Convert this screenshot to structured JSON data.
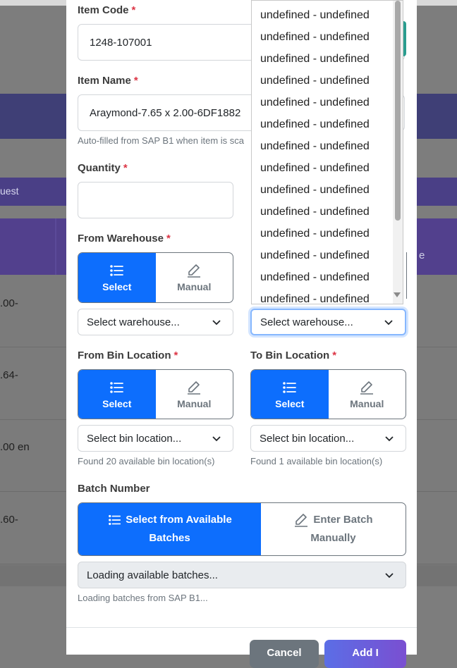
{
  "background": {
    "left_fragments": [
      "uest",
      ".00-",
      ".64-",
      ".00 en",
      ".60-"
    ],
    "right_fragment": "e"
  },
  "form": {
    "item_code": {
      "label": "Item Code",
      "value": "1248-107001"
    },
    "item_name": {
      "label": "Item Name",
      "value": "Araymond-7.65 x 2.00-6DF1882",
      "hint": "Auto-filled from SAP B1 when item is sca"
    },
    "quantity": {
      "label": "Quantity",
      "value": ""
    },
    "from_warehouse": {
      "label": "From Warehouse",
      "select_label": "Select",
      "manual_label": "Manual",
      "dropdown_value": "Select warehouse..."
    },
    "to_warehouse": {
      "dropdown_value": "Select warehouse..."
    },
    "from_bin": {
      "label": "From Bin Location",
      "select_label": "Select",
      "manual_label": "Manual",
      "dropdown_value": "Select bin location...",
      "hint": "Found 20 available bin location(s)"
    },
    "to_bin": {
      "label": "To Bin Location",
      "select_label": "Select",
      "manual_label": "Manual",
      "dropdown_value": "Select bin location...",
      "hint": "Found 1 available bin location(s)"
    },
    "batch": {
      "label": "Batch Number",
      "select_label_line1": "Select from Available",
      "select_label_line2": "Batches",
      "manual_label_line1": "Enter Batch",
      "manual_label_line2": "Manually",
      "dropdown_value": "Loading available batches...",
      "hint": "Loading batches from SAP B1..."
    },
    "required_mark": "*"
  },
  "footer": {
    "cancel_label": "Cancel",
    "add_label": "Add I"
  },
  "dropdown_options": [
    "undefined - undefined",
    "undefined - undefined",
    "undefined - undefined",
    "undefined - undefined",
    "undefined - undefined",
    "undefined - undefined",
    "undefined - undefined",
    "undefined - undefined",
    "undefined - undefined",
    "undefined - undefined",
    "undefined - undefined",
    "undefined - undefined",
    "undefined - undefined",
    "undefined - undefined"
  ],
  "colors": {
    "primary": "#0d6efd",
    "required": "#dc3545",
    "cancel": "#6c757d",
    "add_gradient_start": "#5b6ee6",
    "add_gradient_end": "#7a4fd1"
  },
  "icons": {
    "list": "list-icon",
    "pencil": "pencil-icon",
    "chevron": "chevron-down-icon"
  }
}
